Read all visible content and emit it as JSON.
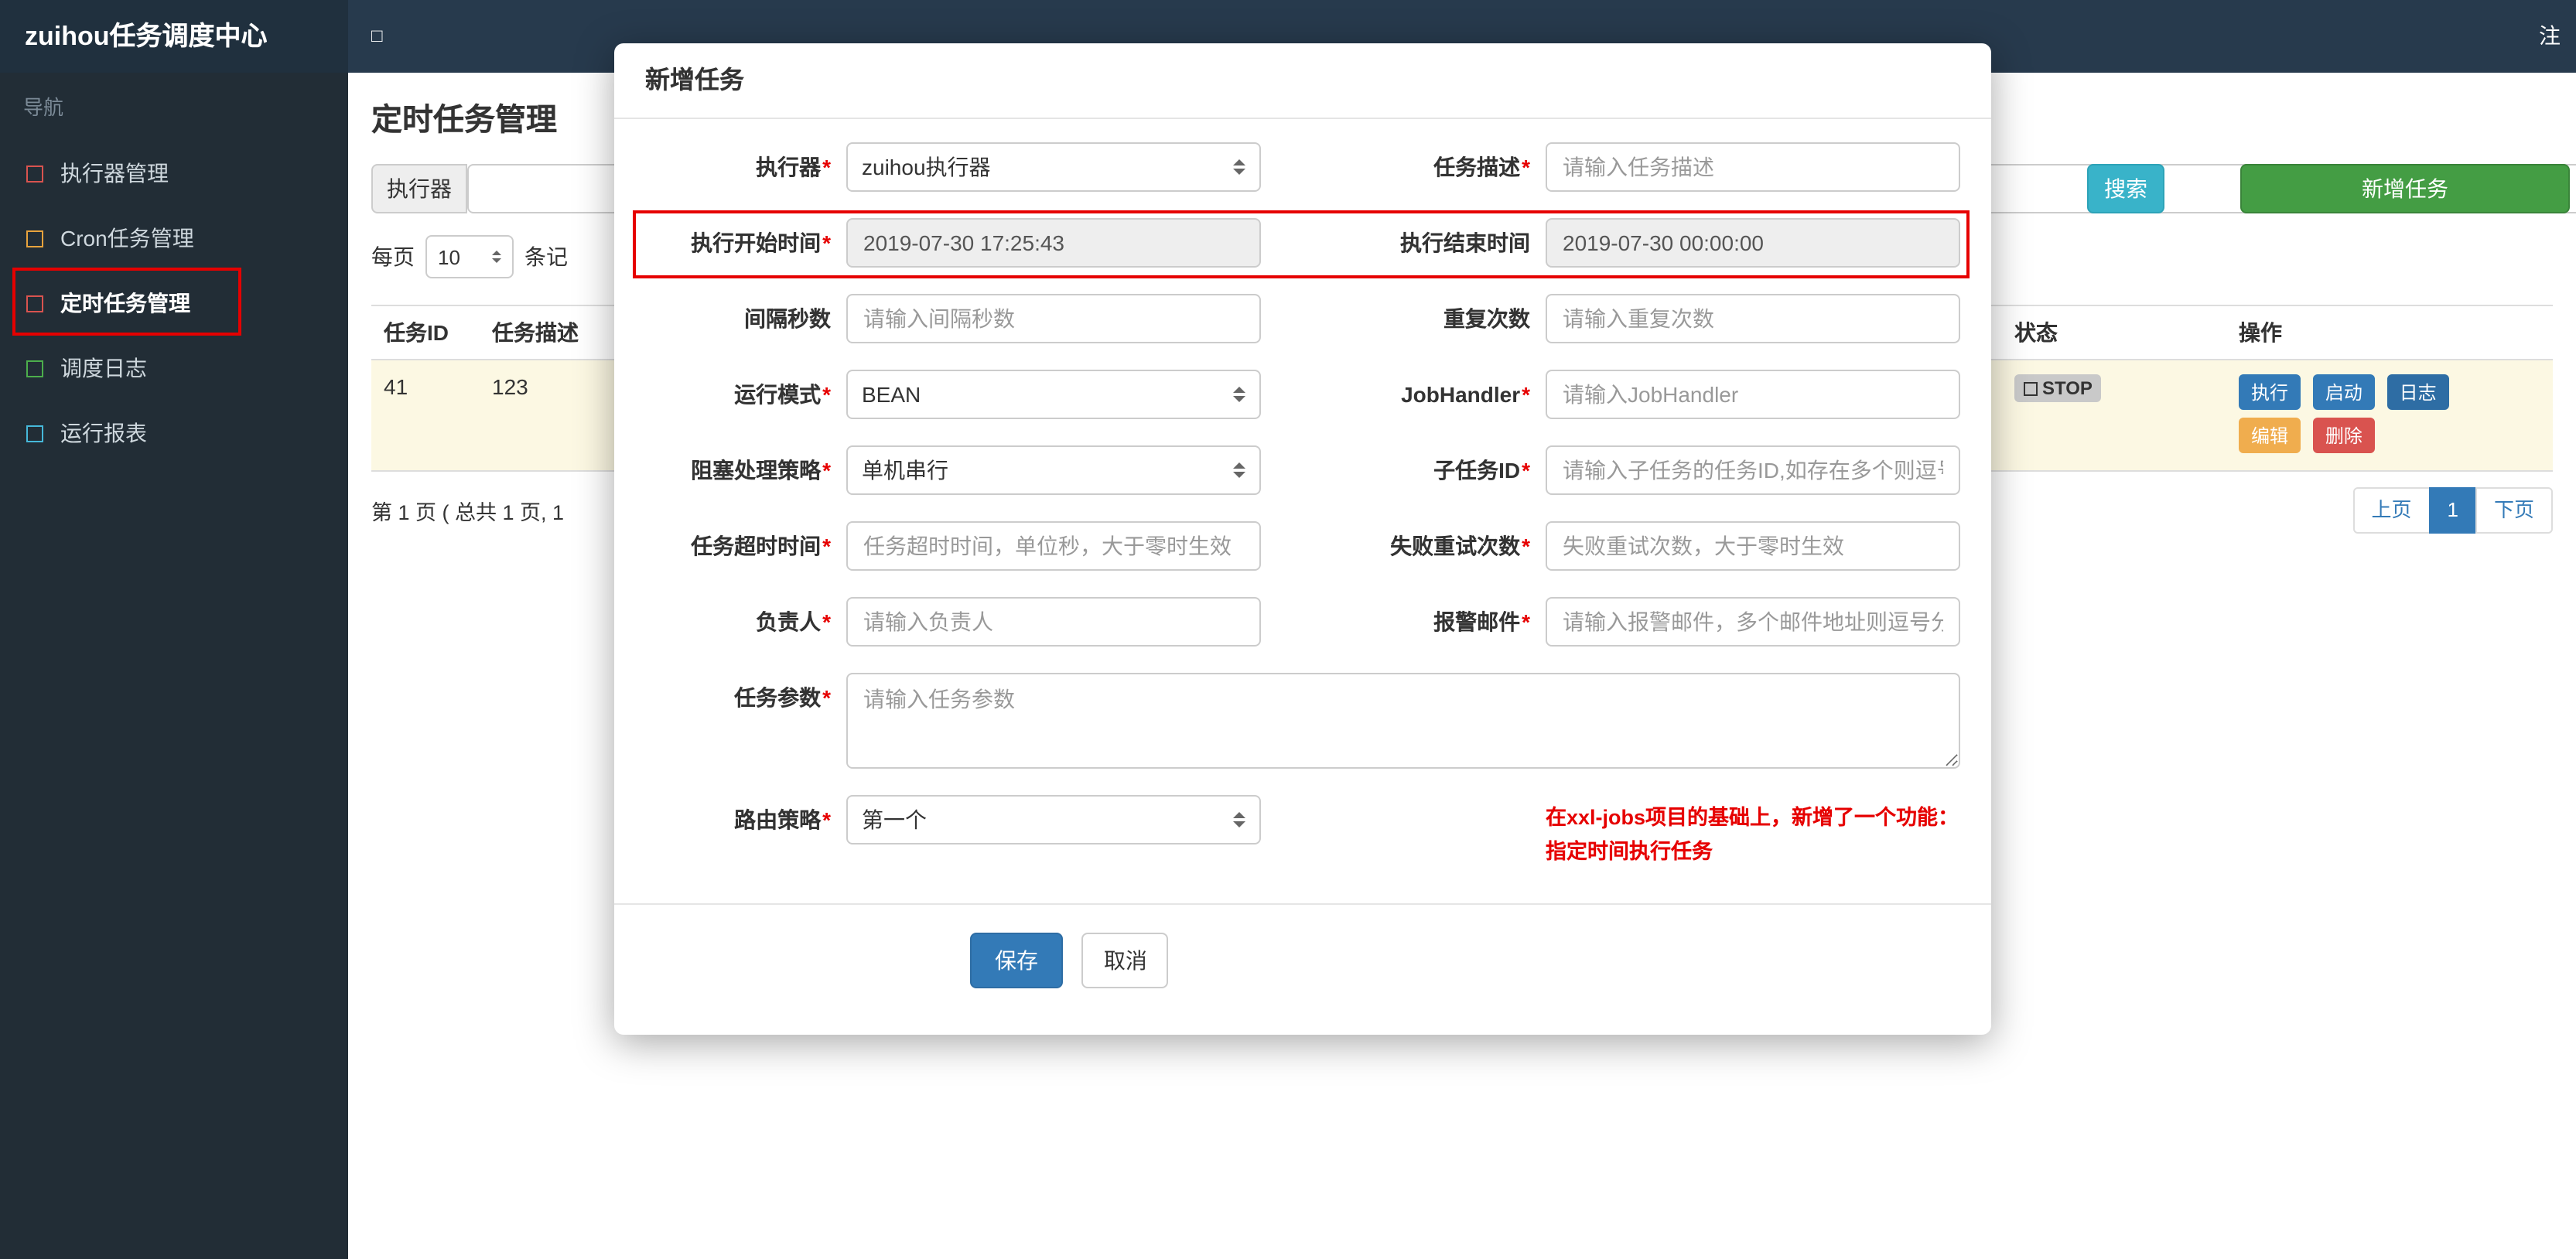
{
  "colors": {
    "annotation_red": "#e60000",
    "accent_blue": "#337ab7",
    "teal": "#39b3c9",
    "green": "#449d44"
  },
  "navbar": {
    "title": "zuihou任务调度中心",
    "toggle_icon": "□",
    "logout": "注销"
  },
  "sidebar": {
    "nav_label": "导航",
    "items": [
      {
        "label": "执行器管理",
        "icon_color": "#d9534f"
      },
      {
        "label": "Cron任务管理",
        "icon_color": "#e8a33d"
      },
      {
        "label": "定时任务管理",
        "icon_color": "#d9534f"
      },
      {
        "label": "调度日志",
        "icon_color": "#4cae4c"
      },
      {
        "label": "运行报表",
        "icon_color": "#46b8da"
      }
    ]
  },
  "page": {
    "title": "定时任务管理",
    "filter": {
      "executor_addon": "执行器",
      "search_button": "搜索",
      "add_button": "新增任务"
    },
    "perpage": {
      "prefix": "每页",
      "value": "10",
      "suffix": "条记"
    },
    "table": {
      "col_job_id": "任务ID",
      "col_job_desc": "任务描述",
      "col_status": "状态",
      "col_actions": "操作",
      "row": {
        "job_id": "41",
        "job_desc": "123",
        "status": "STOP",
        "actions": {
          "run": "执行",
          "start": "启动",
          "log": "日志",
          "edit": "编辑",
          "delete": "删除"
        }
      }
    },
    "pagination": {
      "summary": "第 1 页 ( 总共 1 页, 1",
      "prev": "上页",
      "page": "1",
      "next": "下页"
    }
  },
  "modal": {
    "title": "新增任务",
    "required_marker": "*",
    "fields": {
      "executor": {
        "label": "执行器",
        "value": "zuihou执行器"
      },
      "job_desc": {
        "label": "任务描述",
        "placeholder": "请输入任务描述"
      },
      "start_time": {
        "label": "执行开始时间",
        "value": "2019-07-30 17:25:43"
      },
      "end_time": {
        "label": "执行结束时间",
        "value": "2019-07-30 00:00:00"
      },
      "interval": {
        "label": "间隔秒数",
        "placeholder": "请输入间隔秒数"
      },
      "repeat_count": {
        "label": "重复次数",
        "placeholder": "请输入重复次数"
      },
      "run_mode": {
        "label": "运行模式",
        "value": "BEAN"
      },
      "job_handler": {
        "label": "JobHandler",
        "placeholder": "请输入JobHandler"
      },
      "block_strategy": {
        "label": "阻塞处理策略",
        "value": "单机串行"
      },
      "child_job_id": {
        "label": "子任务ID",
        "placeholder": "请输入子任务的任务ID,如存在多个则逗号分隔"
      },
      "timeout": {
        "label": "任务超时时间",
        "placeholder": "任务超时时间，单位秒，大于零时生效"
      },
      "fail_retry": {
        "label": "失败重试次数",
        "placeholder": "失败重试次数，大于零时生效"
      },
      "owner": {
        "label": "负责人",
        "placeholder": "请输入负责人"
      },
      "alarm_email": {
        "label": "报警邮件",
        "placeholder": "请输入报警邮件，多个邮件地址则逗号分隔"
      },
      "job_params": {
        "label": "任务参数",
        "placeholder": "请输入任务参数"
      },
      "route_strategy": {
        "label": "路由策略",
        "value": "第一个"
      }
    },
    "note_line1": "在xxl-jobs项目的基础上，新增了一个功能：",
    "note_line2": "指定时间执行任务",
    "save_button": "保存",
    "cancel_button": "取消"
  }
}
